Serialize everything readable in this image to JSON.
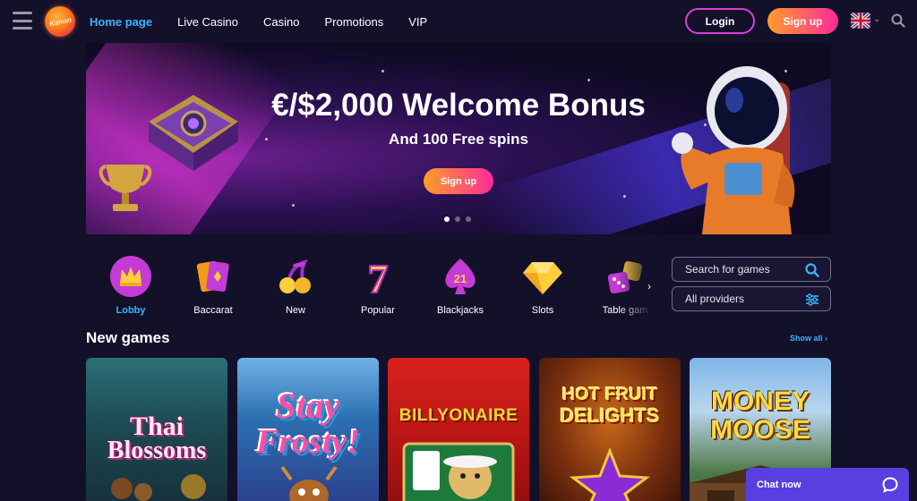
{
  "header": {
    "logo_text": "Kanon",
    "nav": [
      "Home page",
      "Live Casino",
      "Casino",
      "Promotions",
      "VIP"
    ],
    "login_label": "Login",
    "signup_label": "Sign up",
    "language": "en-GB"
  },
  "banner": {
    "title": "€/$2,000 Welcome Bonus",
    "subtitle": "And 100 Free spins",
    "cta_label": "Sign up",
    "slides": 3,
    "active_slide": 1
  },
  "categories": [
    {
      "label": "Lobby",
      "icon": "crown-icon",
      "active": true
    },
    {
      "label": "Baccarat",
      "icon": "cards-icon",
      "active": false
    },
    {
      "label": "New",
      "icon": "cherries-icon",
      "active": false
    },
    {
      "label": "Popular",
      "icon": "seven-icon",
      "active": false
    },
    {
      "label": "Blackjacks",
      "icon": "spade-21-icon",
      "active": false
    },
    {
      "label": "Slots",
      "icon": "diamond-icon",
      "active": false
    },
    {
      "label": "Table gam",
      "icon": "dice-icon",
      "active": false
    }
  ],
  "search": {
    "placeholder": "Search for games"
  },
  "providers": {
    "label": "All providers"
  },
  "new_games": {
    "title": "New games",
    "show_all": "Show all",
    "games": [
      "Thai Blossoms",
      "Stay Frosty!",
      "BILLYONAIRE",
      "HOT FRUIT DELIGHTS",
      "MONEY MOOSE"
    ]
  },
  "game_art": {
    "thai_line1": "Thai",
    "thai_line2": "Blossoms",
    "frosty_line1": "Stay",
    "frosty_line2": "Frosty!",
    "billy": "BILLYONAIRE",
    "hot_line1": "HOT FRUIT",
    "hot_line2": "DELIGHTS",
    "moose_line1": "MONEY",
    "moose_line2": "MOOSE"
  },
  "chat": {
    "label": "Chat now"
  },
  "colors": {
    "accent_blue": "#3bb4ff",
    "cta_start": "#ff9d2a",
    "cta_end": "#ff2a9a",
    "login_border": "#d63fd6",
    "chat_bg": "#5a3fe0"
  }
}
